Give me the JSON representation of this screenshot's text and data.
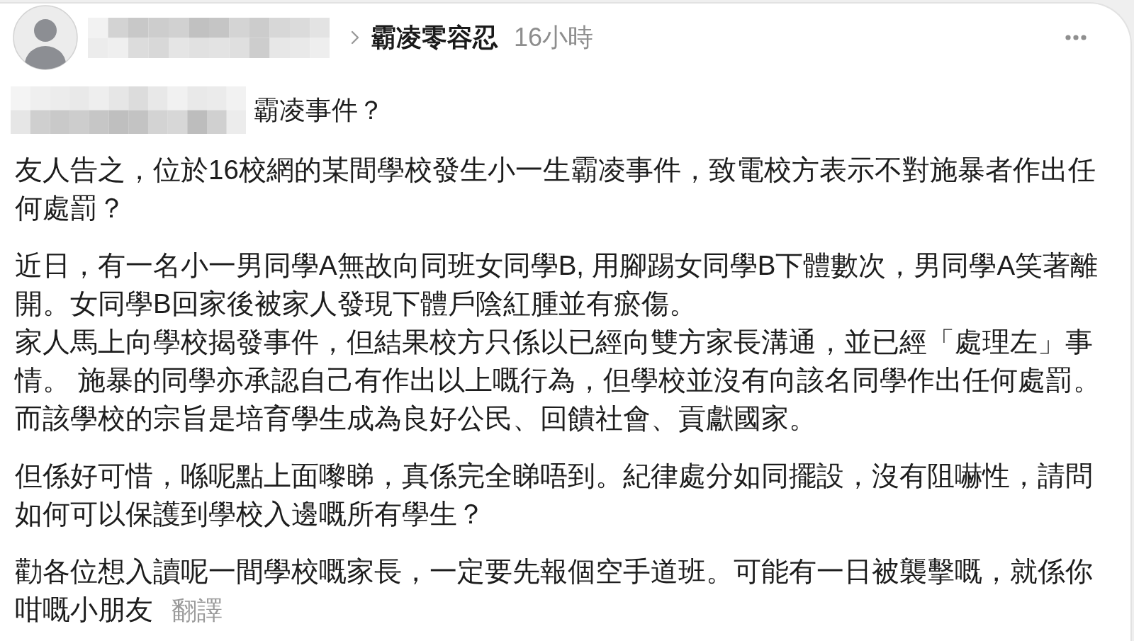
{
  "post": {
    "author": {
      "name_redacted": true
    },
    "community": "霸凌零容忍",
    "time": "16小時",
    "title": {
      "mention_redacted": true,
      "text": "霸凌事件？"
    },
    "paragraphs": [
      {
        "lines": [
          "友人告之，位於16校網的某間學校發生小一生霸凌事件，致電校方表示不對施暴者作出任何處罰？"
        ]
      },
      {
        "lines": [
          "近日，有一名小一男同學A無故向同班女同學B, 用腳踢女同學B下體數次，男同學A笑著離開。女同學B回家後被家人發現下體戶陰紅腫並有瘀傷。",
          "家人馬上向學校揭發事件，但結果校方只係以已經向雙方家長溝通，並已經「處理左」事情。 施暴的同學亦承認自己有作出以上嘅行為，但學校並沒有向該名同學作出任何處罰。",
          "而該學校的宗旨是培育學生成為良好公民、回饋社會、貢獻國家。"
        ]
      },
      {
        "lines": [
          "但係好可惜，喺呢點上面嚟睇，真係完全睇唔到。紀律處分如同擺設，沒有阻嚇性，請問如何可以保護到學校入邊嘅所有學生？"
        ]
      },
      {
        "lines": [
          "勸各位想入讀呢一間學校嘅家長，一定要先報個空手道班。可能有一日被襲擊嘅，就係你咁嘅小朋友"
        ]
      }
    ],
    "translate_link": "翻譯"
  }
}
